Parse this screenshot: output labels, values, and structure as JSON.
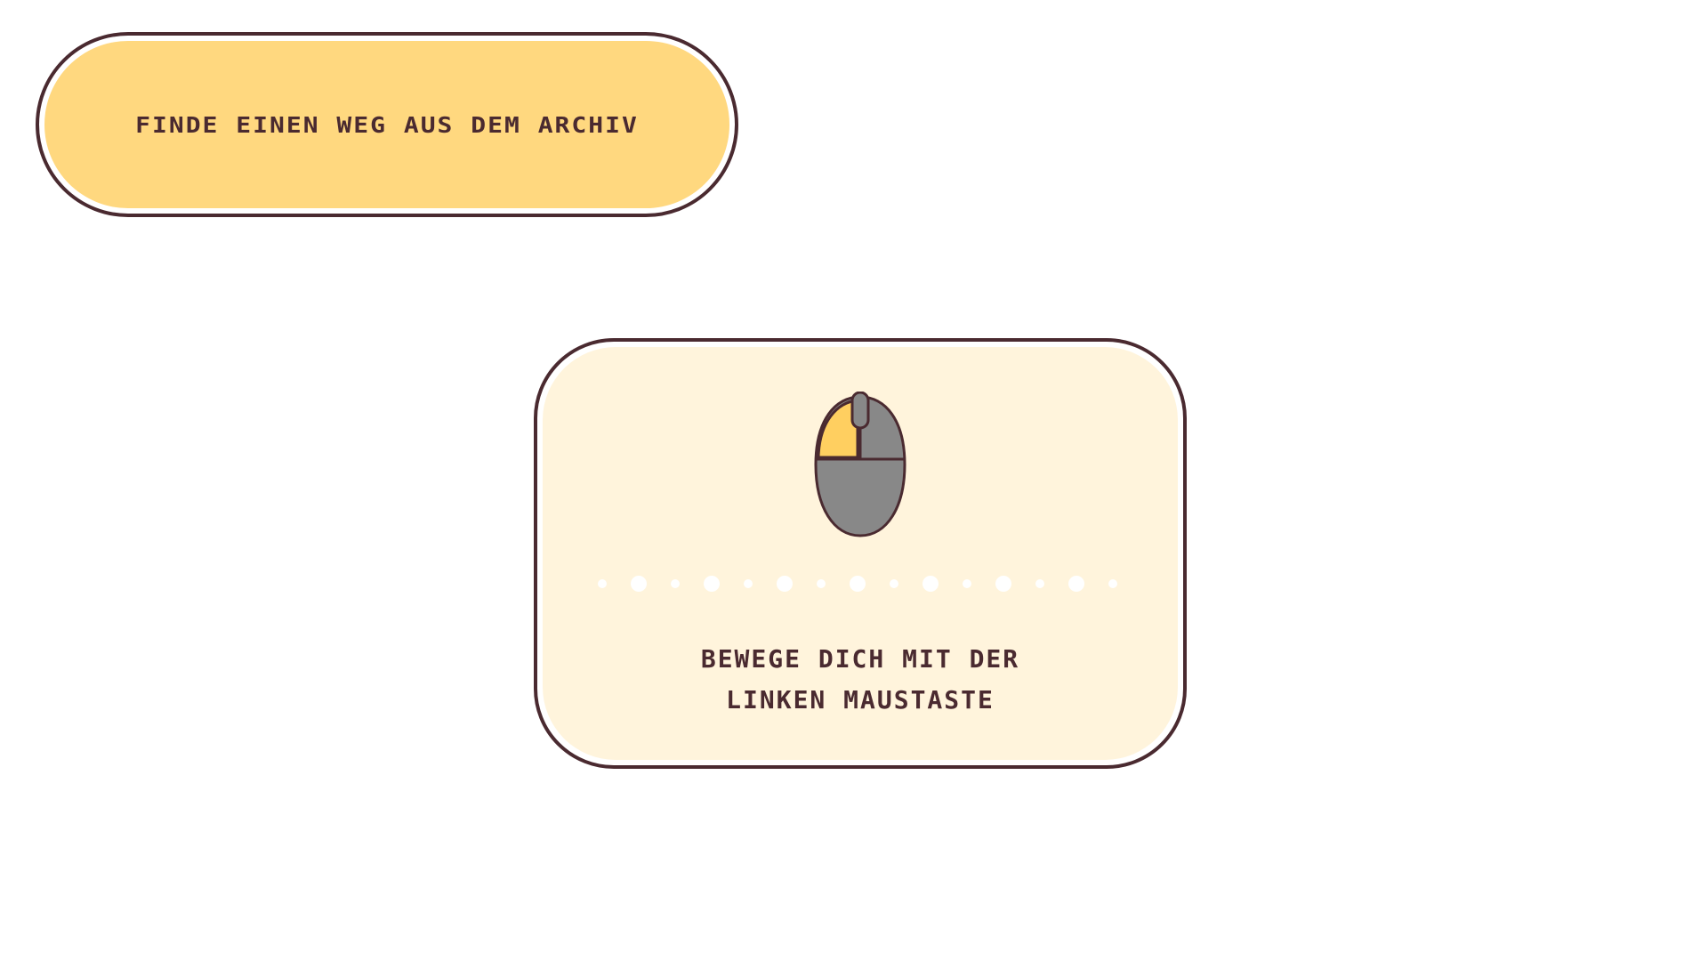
{
  "objective": {
    "text": "FINDE EINEN WEG AUS DEM ARCHIV"
  },
  "hint": {
    "icon": "mouse-left-click-icon",
    "line1": "BEWEGE DICH MIT DER",
    "line2": "LINKEN MAUSTASTE"
  },
  "colors": {
    "outline": "#4a2a30",
    "objective_fill": "#ffd87f",
    "card_fill": "#fff4dc",
    "mouse_body": "#888888",
    "mouse_highlight": "#ffcf60",
    "dots": "#ffffff"
  }
}
